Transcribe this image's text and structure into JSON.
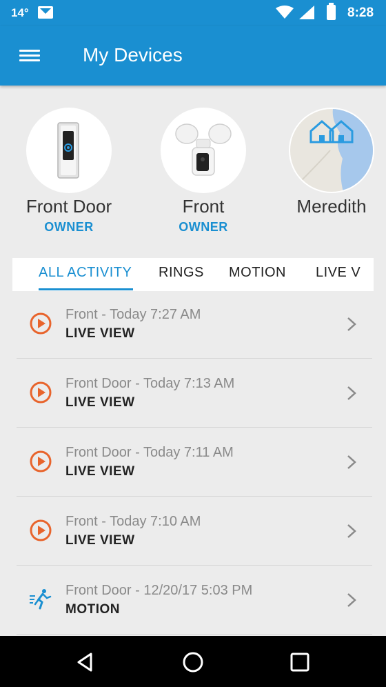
{
  "status_bar": {
    "temperature": "14°",
    "time": "8:28"
  },
  "header": {
    "title": "My Devices"
  },
  "devices": [
    {
      "name": "Front Door",
      "role": "OWNER"
    },
    {
      "name": "Front",
      "role": "OWNER"
    },
    {
      "name": "Meredith",
      "role": ""
    }
  ],
  "tabs": [
    {
      "label": "ALL ACTIVITY",
      "active": true
    },
    {
      "label": "RINGS",
      "active": false
    },
    {
      "label": "MOTION",
      "active": false
    },
    {
      "label": "LIVE V",
      "active": false
    }
  ],
  "activity": [
    {
      "title": "Front - Today 7:27 AM",
      "kind": "LIVE VIEW",
      "icon": "play-circle-icon"
    },
    {
      "title": "Front Door - Today 7:13 AM",
      "kind": "LIVE VIEW",
      "icon": "play-circle-icon"
    },
    {
      "title": "Front Door - Today 7:11 AM",
      "kind": "LIVE VIEW",
      "icon": "play-circle-icon"
    },
    {
      "title": "Front - Today 7:10 AM",
      "kind": "LIVE VIEW",
      "icon": "play-circle-icon"
    },
    {
      "title": "Front Door - 12/20/17 5:03 PM",
      "kind": "MOTION",
      "icon": "running-person-icon"
    }
  ],
  "colors": {
    "primary": "#1a8fd1",
    "accent_orange": "#e8642c",
    "background": "#ececec"
  }
}
